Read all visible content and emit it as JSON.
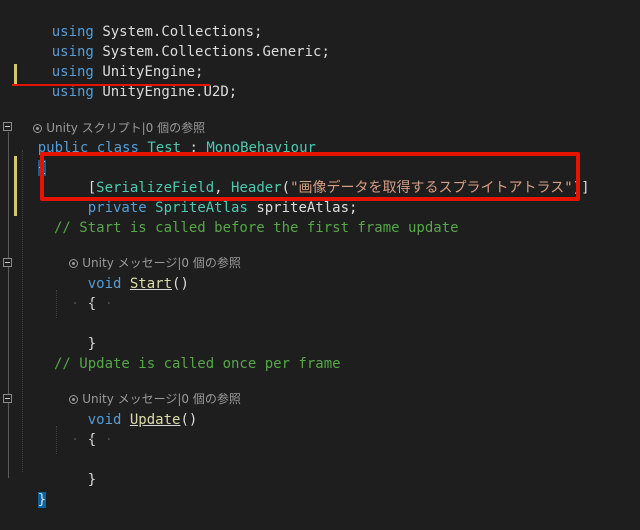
{
  "code": {
    "line1": {
      "kw": "using",
      "ns": "System.Collections",
      "end": ";"
    },
    "line2": {
      "kw": "using",
      "ns": "System.Collections.Generic",
      "end": ";"
    },
    "line3": {
      "kw": "using",
      "ns": "UnityEngine",
      "end": ";"
    },
    "line4": {
      "kw": "using",
      "ns": "UnityEngine.U2D",
      "end": ";"
    },
    "lens_class": "Unity スクリプト|0 個の参照",
    "class_decl": {
      "kw1": "public",
      "kw2": "class",
      "name": "Test",
      "colon": ":",
      "base": "MonoBehaviour"
    },
    "open_brace": "{",
    "attr_line": {
      "open": "[",
      "attr1": "SerializeField",
      "comma": ",",
      "attr2": "Header",
      "paren_open": "(",
      "string": "\"画像データを取得するスプライトアトラス\"",
      "paren_close": ")]"
    },
    "field_line": {
      "kw": "private",
      "type": "SpriteAtlas",
      "name": "spriteAtlas",
      "end": ";"
    },
    "comment_start": "// Start is called before the first frame update",
    "lens_start": "Unity メッセージ|0 個の参照",
    "start_decl": {
      "kw": "void",
      "name": "Start",
      "parens": "()"
    },
    "start_open": "{",
    "start_close": "}",
    "comment_update": "// Update is called once per frame",
    "lens_update": "Unity メッセージ|0 個の参照",
    "update_decl": {
      "kw": "void",
      "name": "Update",
      "parens": "()"
    },
    "update_open": "{",
    "update_close": "}",
    "close_brace": "}"
  },
  "colors": {
    "background": "#1e1e1e",
    "keyword": "#569cd6",
    "type": "#4ec9b0",
    "string": "#d69d85",
    "comment": "#57a64a",
    "highlight_red": "#e51400",
    "change_mark": "#d7c66b"
  }
}
